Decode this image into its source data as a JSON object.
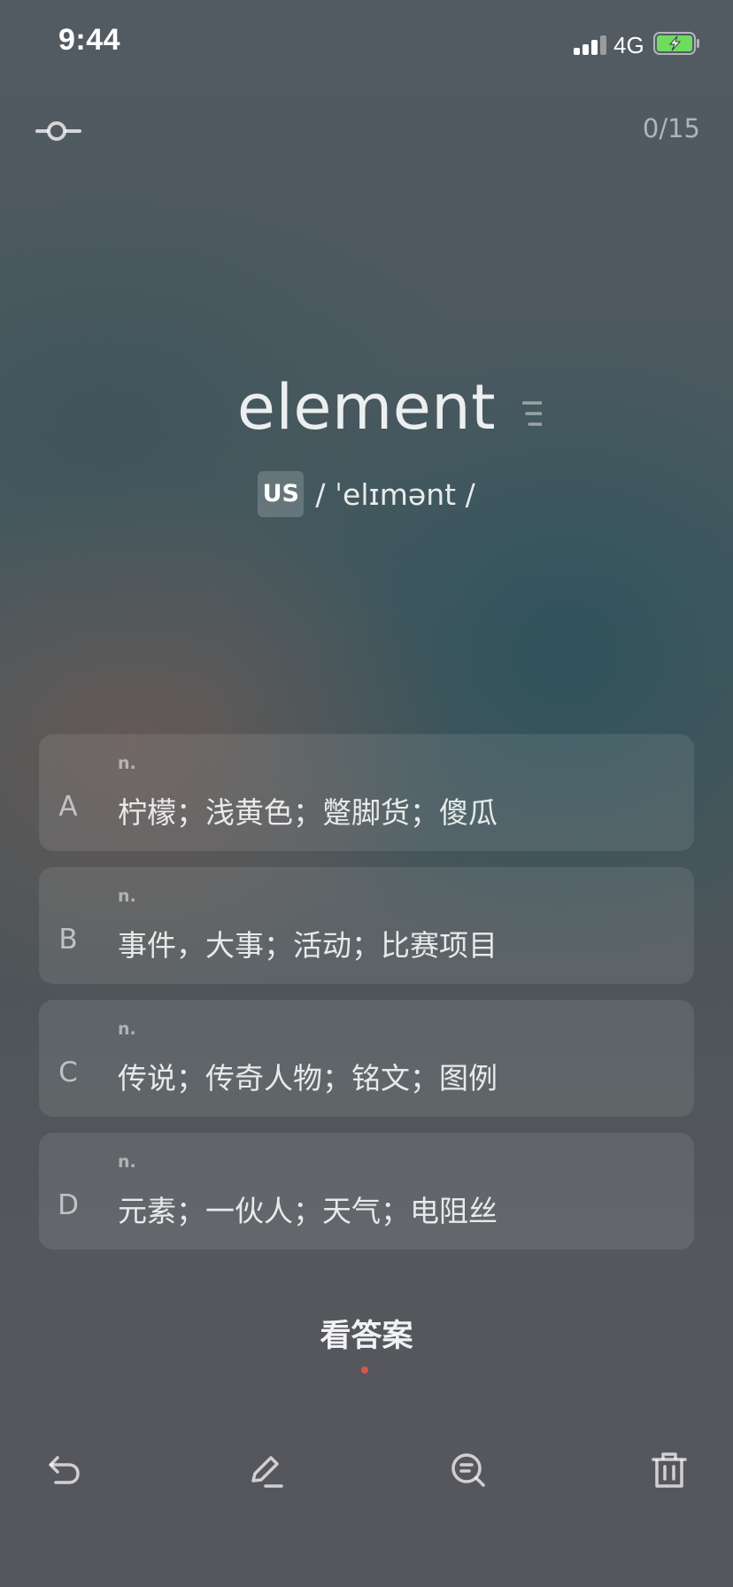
{
  "status_bar": {
    "time": "9:44",
    "network": "4G",
    "signal_icon": "cellular-signal-icon",
    "battery_icon": "battery-charging-icon",
    "battery_color": "#6fdc5f"
  },
  "top_bar": {
    "settings_icon": "slider-icon",
    "progress": "0/15"
  },
  "word": {
    "text": "element",
    "accent": "US",
    "phonetic": "/ ˈelɪmənt /",
    "menu_icon": "menu-lines-icon"
  },
  "options": [
    {
      "letter": "A",
      "pos": "n.",
      "meaning": "柠檬；浅黄色；蹩脚货；傻瓜"
    },
    {
      "letter": "B",
      "pos": "n.",
      "meaning": "事件，大事；活动；比赛项目"
    },
    {
      "letter": "C",
      "pos": "n.",
      "meaning": "传说；传奇人物；铭文；图例"
    },
    {
      "letter": "D",
      "pos": "n.",
      "meaning": "元素；一伙人；天气；电阻丝"
    }
  ],
  "show_answer": "看答案",
  "accent_dot_color": "#d9534f",
  "toolbar": {
    "undo_icon": "undo-icon",
    "edit_icon": "edit-icon",
    "search_icon": "search-detail-icon",
    "delete_icon": "trash-icon"
  }
}
